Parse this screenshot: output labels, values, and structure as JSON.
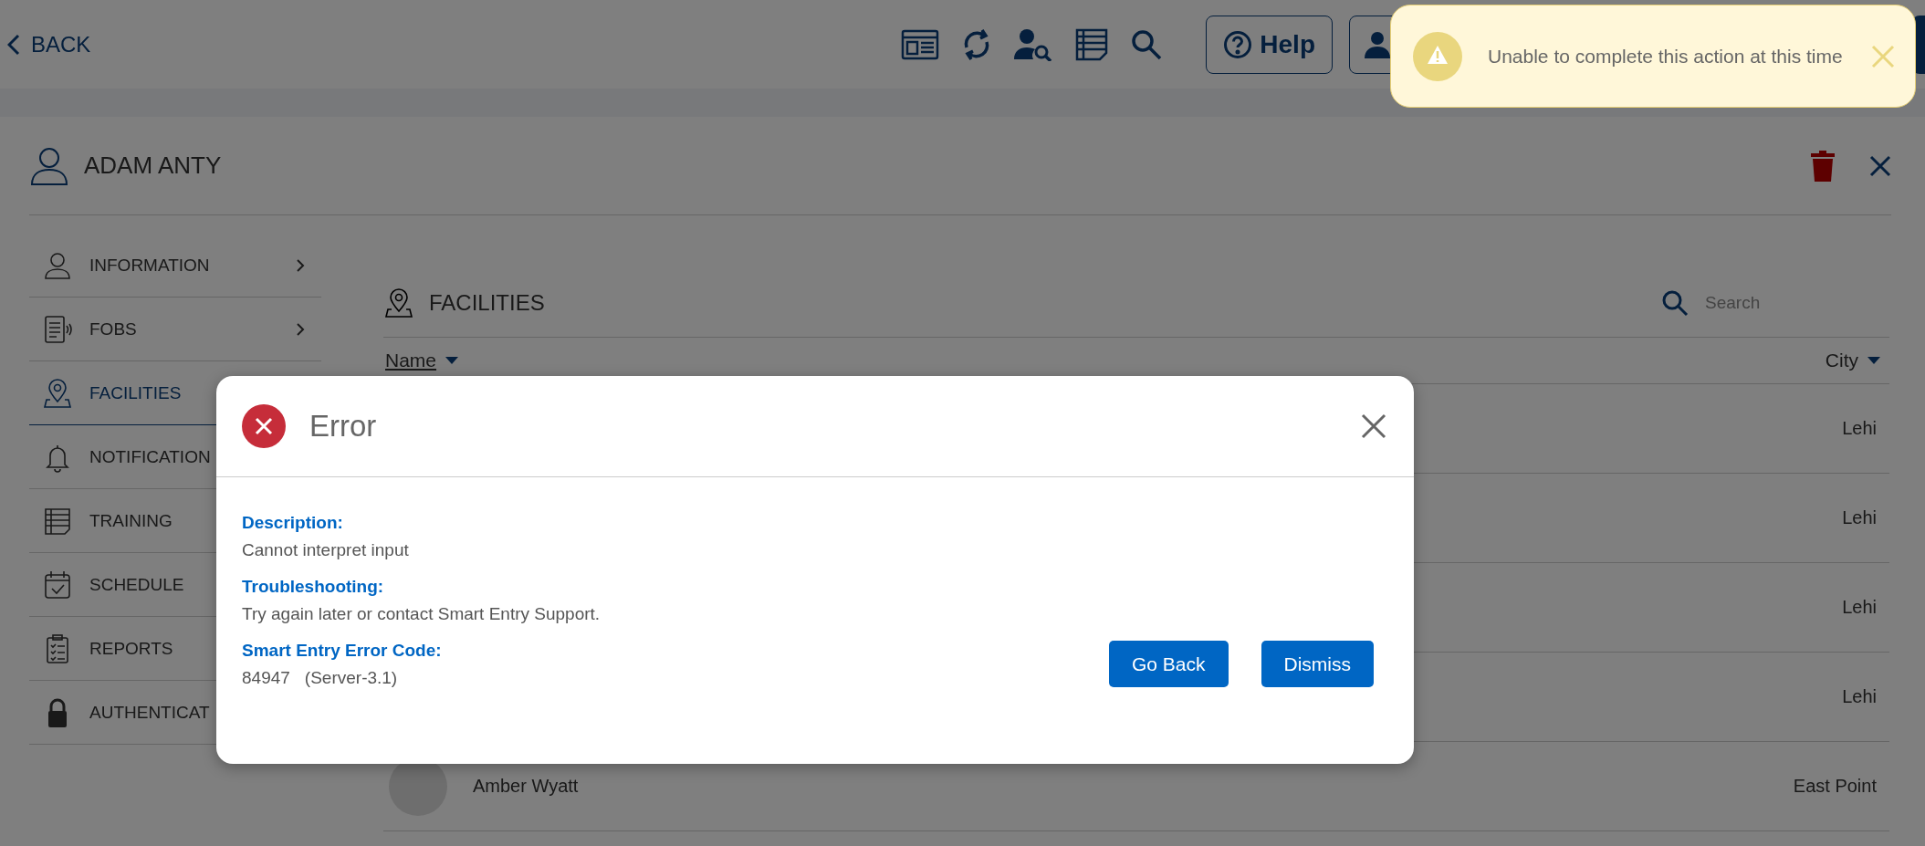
{
  "top_bar": {
    "back": "BACK",
    "help": "Help"
  },
  "profile": {
    "name": "ADAM ANTY"
  },
  "sidebar": {
    "items": [
      {
        "label": "INFORMATION",
        "chevron": true,
        "selected": false
      },
      {
        "label": "FOBS",
        "chevron": true,
        "selected": false
      },
      {
        "label": "FACILITIES",
        "selected": true
      },
      {
        "label": "NOTIFICATION",
        "selected": false
      },
      {
        "label": "TRAINING",
        "selected": false
      },
      {
        "label": "SCHEDULE",
        "selected": false
      },
      {
        "label": "REPORTS",
        "selected": false
      },
      {
        "label": "AUTHENTICAT",
        "selected": false
      }
    ]
  },
  "facilities": {
    "title": "FACILITIES",
    "search": {
      "placeholder": "Search"
    },
    "columns": [
      {
        "label": "Name",
        "selected": true
      },
      {
        "label": "City",
        "selected": false
      }
    ],
    "rows": [
      {
        "city": "Lehi"
      },
      {
        "city": "Lehi"
      },
      {
        "city": "Lehi"
      },
      {
        "city": "Lehi"
      },
      {
        "name": "Amber Wyatt",
        "city": "East Point"
      }
    ]
  },
  "toast": {
    "message": "Unable to complete this action at this time"
  },
  "dialog": {
    "title": "Error",
    "sections": [
      {
        "heading": "Description:",
        "text": "Cannot interpret input"
      },
      {
        "heading": "Troubleshooting:",
        "text": "Try again later or contact Smart Entry Support."
      },
      {
        "heading": "Smart Entry Error Code:",
        "code": "84947",
        "detail": "(Server-3.1)"
      }
    ],
    "buttons": [
      "Go Back",
      "Dismiss"
    ]
  }
}
